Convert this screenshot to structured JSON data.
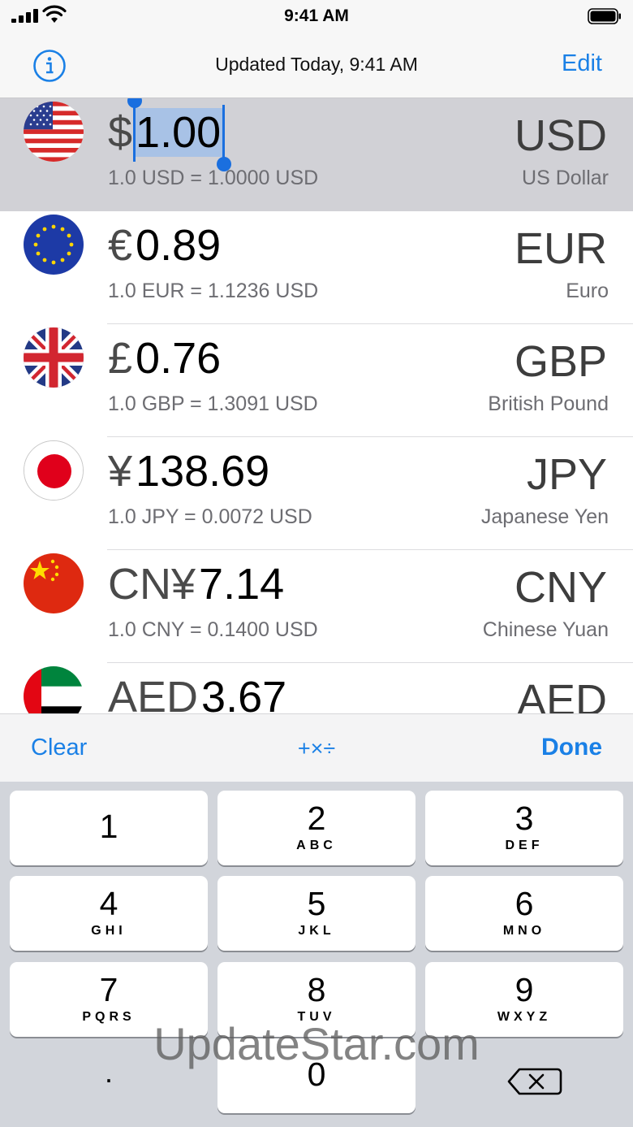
{
  "status_bar": {
    "time": "9:41 AM"
  },
  "nav": {
    "info_icon": "info-circle-icon",
    "title": "Updated Today, 9:41 AM",
    "edit_label": "Edit"
  },
  "currencies": [
    {
      "flag": "us-flag-icon",
      "symbol": "$",
      "amount": "1.00",
      "rate": "1.0 USD = 1.0000 USD",
      "code": "USD",
      "name": "US Dollar",
      "selected": true
    },
    {
      "flag": "eu-flag-icon",
      "symbol": "€",
      "amount": "0.89",
      "rate": "1.0 EUR = 1.1236 USD",
      "code": "EUR",
      "name": "Euro"
    },
    {
      "flag": "uk-flag-icon",
      "symbol": "£",
      "amount": "0.76",
      "rate": "1.0 GBP = 1.3091 USD",
      "code": "GBP",
      "name": "British Pound"
    },
    {
      "flag": "jp-flag-icon",
      "symbol": "¥",
      "amount": "138.69",
      "rate": "1.0 JPY = 0.0072 USD",
      "code": "JPY",
      "name": "Japanese Yen"
    },
    {
      "flag": "cn-flag-icon",
      "symbol": "CN¥",
      "amount": "7.14",
      "rate": "1.0 CNY = 0.1400 USD",
      "code": "CNY",
      "name": "Chinese Yuan"
    },
    {
      "flag": "ae-flag-icon",
      "symbol": "AED",
      "amount": "3.67",
      "rate": "",
      "code": "AED",
      "name": ""
    }
  ],
  "accessory": {
    "clear_label": "Clear",
    "ops_label": "+×÷",
    "done_label": "Done"
  },
  "keypad": {
    "keys": [
      {
        "digit": "1",
        "letters": ""
      },
      {
        "digit": "2",
        "letters": "ABC"
      },
      {
        "digit": "3",
        "letters": "DEF"
      },
      {
        "digit": "4",
        "letters": "GHI"
      },
      {
        "digit": "5",
        "letters": "JKL"
      },
      {
        "digit": "6",
        "letters": "MNO"
      },
      {
        "digit": "7",
        "letters": "PQRS"
      },
      {
        "digit": "8",
        "letters": "TUV"
      },
      {
        "digit": "9",
        "letters": "WXYZ"
      }
    ],
    "decimal": ".",
    "zero": "0",
    "backspace_icon": "backspace-icon"
  },
  "watermark": "UpdateStar.com",
  "colors": {
    "accent": "#1a80e6",
    "selection": "#a8c2e6",
    "selected_row": "#d1d1d6"
  }
}
